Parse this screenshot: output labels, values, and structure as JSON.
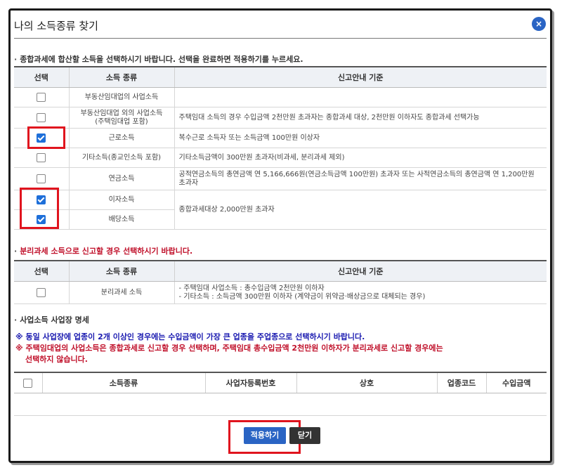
{
  "title": "나의 소득종류 찾기",
  "close_glyph": "×",
  "section1": {
    "instruction": "종합과세에 합산할 소득을 선택하시기 바랍니다. 선택을 완료하면 적용하기를 누르세요.",
    "headers": [
      "선택",
      "소득 종류",
      "신고안내 기준"
    ],
    "rows": [
      {
        "checked": false,
        "type": "부동산임대업의 사업소득",
        "guide": ""
      },
      {
        "checked": false,
        "type": "부동산임대업 외의 사업소득\n(주택임대업 포함)",
        "guide": "주택임대 소득의 경우 수입금액 2천만원 초과자는 종합과세 대상, 2천만원 이하자도 종합과세 선택가능"
      },
      {
        "checked": true,
        "type": "근로소득",
        "guide": "복수근로 소득자 또는 소득금액 100만원 이상자"
      },
      {
        "checked": false,
        "type": "기타소득(종교인소득 포함)",
        "guide": "기타소득금액이 300만원 초과자(비과세, 분리과세 제외)"
      },
      {
        "checked": false,
        "type": "연금소득",
        "guide": "공적연금소득의 총연금액 연 5,166,666원(연금소득금액 100만원) 초과자 또는 사적연금소득의 총연금액 연 1,200만원 초과자"
      },
      {
        "checked": true,
        "type": "이자소득",
        "guide": "종합과세대상 2,000만원 초과자"
      },
      {
        "checked": true,
        "type": "배당소득",
        "guide": ""
      }
    ]
  },
  "section2": {
    "instruction": "분리과세 소득으로 신고할 경우 선택하시기 바랍니다.",
    "headers": [
      "선택",
      "소득 종류",
      "신고안내 기준"
    ],
    "row": {
      "checked": false,
      "type": "분리과세 소득",
      "guide_line1": "- 주택임대 사업소득 : 총수입금액 2천만원 이하자",
      "guide_line2": "- 기타소득 : 소득금액 300만원 이하자 (계약금이 위약금·배상금으로 대체되는 경우)"
    }
  },
  "section3": {
    "label": "사업소득 사업장 명세",
    "notice1": "※ 동일 사업장에 업종이 2개 이상인 경우에는 수입금액이 가장 큰 업종을 주업종으로 선택하시기 바랍니다.",
    "notice2_line1": "※ 주택임대업의 사업소득은 종합과세로 신고할 경우 선택하며, 주택임대 총수입금액 2천만원 이하자가 분리과세로 신고할 경우에는",
    "notice2_line2": "선택하지 않습니다.",
    "headers": [
      "소득종류",
      "사업자등록번호",
      "상호",
      "업종코드",
      "수입금액"
    ]
  },
  "buttons": {
    "apply": "적용하기",
    "close": "닫기"
  },
  "colors": {
    "highlight_box": "#e0141e",
    "apply_button": "#2a64c4",
    "close_button": "#333333",
    "notice_blue": "#1a1ab0",
    "notice_red": "#c0102a"
  }
}
